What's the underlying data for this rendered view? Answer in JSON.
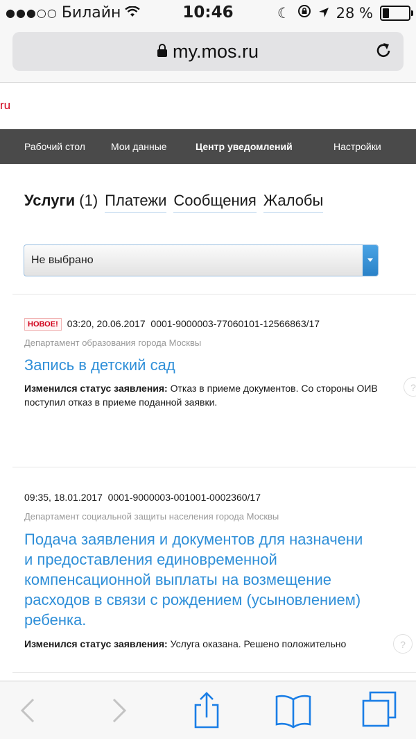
{
  "status_bar": {
    "carrier": "Билайн",
    "time": "10:46",
    "battery": "28 %",
    "battery_level": 0.28
  },
  "browser": {
    "url": "my.mos.ru"
  },
  "site": {
    "logo_fragment": "ru",
    "nav": [
      "Рабочий стол",
      "Мои данные",
      "Центр уведомлений",
      "Настройки"
    ],
    "nav_active": "Центр уведомлений"
  },
  "tabs": {
    "items": [
      {
        "label": "Услуги",
        "count": "(1)"
      },
      {
        "label": "Платежи"
      },
      {
        "label": "Сообщения"
      },
      {
        "label": "Жалобы"
      }
    ]
  },
  "filter": {
    "selected": "Не выбрано"
  },
  "notifications": [
    {
      "badge": "НОВОЕ!",
      "datetime": "03:20, 20.06.2017",
      "number": "0001-9000003-77060101-12566863/17",
      "department": "Департамент образования города Москвы",
      "title_lines": [
        "Запись в детский сад"
      ],
      "status_label": "Изменился статус заявления:",
      "status_text": " Отказ в приеме документов. Со стороны ОИВ поступил отказ в приеме поданной заявки.",
      "help": "?"
    },
    {
      "badge": "",
      "datetime": "09:35, 18.01.2017",
      "number": "0001-9000003-001001-0002360/17",
      "department": "Департамент социальной защиты населения города Москвы",
      "title_lines": [
        "Подача заявления и документов для назначени",
        "и предоставления единовременной",
        "компенсационной выплаты на возмещение",
        "расходов в связи с рождением (усыновлением)",
        "ребенка."
      ],
      "status_label": "Изменился статус заявления:",
      "status_text": " Услуга оказана. Решено положительно",
      "help": "?"
    }
  ]
}
